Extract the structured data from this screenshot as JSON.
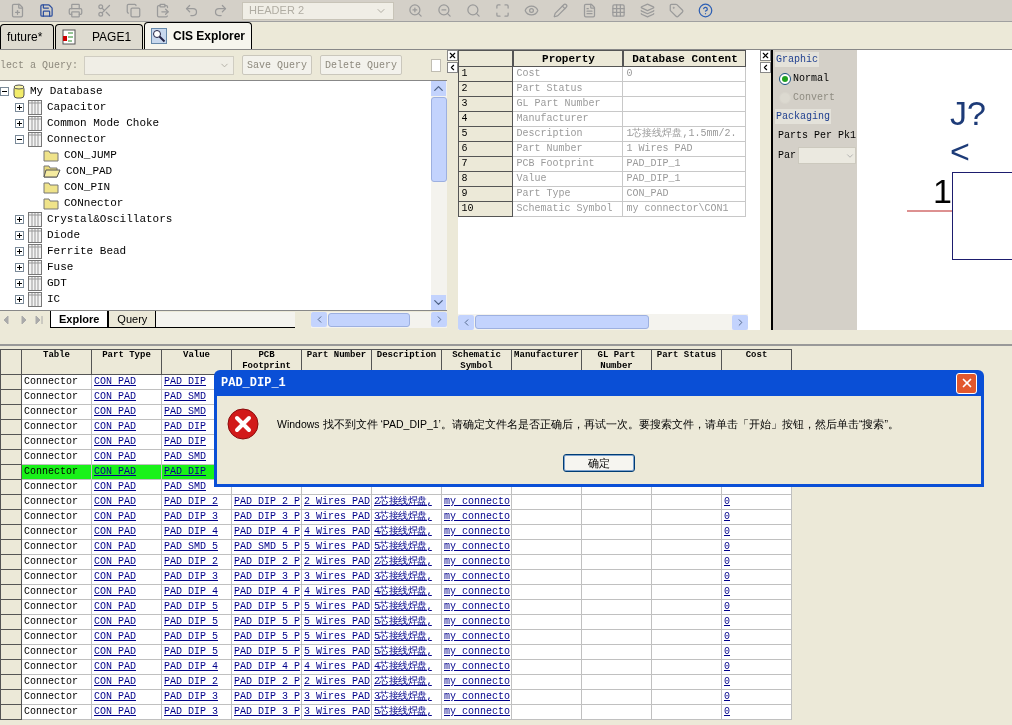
{
  "toolbar": {
    "style_combo": {
      "value": "HEADER 2",
      "disabled": true
    }
  },
  "document_tabs": [
    {
      "label": "future*",
      "selected": false,
      "kind": "plain"
    },
    {
      "label": "PAGE1",
      "selected": false,
      "kind": "schematic"
    },
    {
      "label": "CIS Explorer",
      "selected": true,
      "kind": "explorer"
    }
  ],
  "query_bar": {
    "label": "lect a Query:",
    "combo_disabled": true,
    "buttons": [
      {
        "label": "Save Query",
        "disabled": true
      },
      {
        "label": "Delete Query",
        "disabled": true
      }
    ],
    "checkbox": {
      "checked": false
    }
  },
  "tree": {
    "label": "My Database",
    "kind": "database",
    "expanded": true,
    "children": [
      {
        "label": "Capacitor",
        "kind": "table",
        "expanded": false
      },
      {
        "label": "Common Mode Choke",
        "kind": "table",
        "expanded": false
      },
      {
        "label": "Connector",
        "kind": "table",
        "expanded": true,
        "children": [
          {
            "label": "CON_JUMP",
            "kind": "folder",
            "selected": false
          },
          {
            "label": "CON_PAD",
            "kind": "folder",
            "selected": true
          },
          {
            "label": "CON_PIN",
            "kind": "folder",
            "selected": false
          },
          {
            "label": "CONnector",
            "kind": "folder",
            "selected": false
          }
        ]
      },
      {
        "label": "Crystal&Oscillators",
        "kind": "table",
        "expanded": false
      },
      {
        "label": "Diode",
        "kind": "table",
        "expanded": false
      },
      {
        "label": "Ferrite Bead",
        "kind": "table",
        "expanded": false
      },
      {
        "label": "Fuse",
        "kind": "table",
        "expanded": false
      },
      {
        "label": "GDT",
        "kind": "table",
        "expanded": false
      },
      {
        "label": "IC",
        "kind": "table",
        "expanded": false
      }
    ]
  },
  "explorer_tabs": [
    {
      "label": "Explore",
      "selected": true
    },
    {
      "label": "Query",
      "selected": false
    }
  ],
  "property_grid": {
    "columns": [
      "Property",
      "Database Content"
    ],
    "rows": [
      {
        "number": "1",
        "property": "Cost",
        "value": "0"
      },
      {
        "number": "2",
        "property": "Part Status"
      },
      {
        "number": "3",
        "property": "GL Part Number"
      },
      {
        "number": "4",
        "property": "Manufacturer"
      },
      {
        "number": "5",
        "property": "Description",
        "value": "1芯接线焊盘,1.5mm/2."
      },
      {
        "number": "6",
        "property": "Part Number",
        "value": "1 Wires PAD"
      },
      {
        "number": "7",
        "property": "PCB Footprint",
        "value": "PAD_DIP_1"
      },
      {
        "number": "8",
        "property": "Value",
        "value": "PAD_DIP_1"
      },
      {
        "number": "9",
        "property": "Part Type",
        "value": "CON_PAD"
      },
      {
        "number": "10",
        "property": "Schematic Symbol",
        "value": "my connector\\CON1"
      }
    ]
  },
  "preview_options": {
    "graphic_heading": "Graphic",
    "views": [
      {
        "label": "Normal",
        "selected": true,
        "disabled": false
      },
      {
        "label": "Convert",
        "selected": false,
        "disabled": true
      }
    ],
    "packaging_heading": "Packaging",
    "parts_per_package": "Parts Per Pk1",
    "part_label": "Par",
    "part_combo_disabled": true
  },
  "preview": {
    "reference": "J?",
    "value": "<",
    "pin_number": "1"
  },
  "parts_table": {
    "columns": [
      "Table",
      "Part Type",
      "Value",
      "PCB Footprint",
      "Part Number",
      "Description",
      "Schematic Symbol",
      "Manufacturer",
      "GL Part Number",
      "Part Status",
      "Cost"
    ],
    "rows": [
      {
        "table": "Connector",
        "part_type": "CON PAD",
        "value": "PAD DIP",
        "selected": false
      },
      {
        "table": "Connector",
        "part_type": "CON PAD",
        "value": "PAD SMD",
        "selected": false
      },
      {
        "table": "Connector",
        "part_type": "CON PAD",
        "value": "PAD SMD",
        "selected": false
      },
      {
        "table": "Connector",
        "part_type": "CON PAD",
        "value": "PAD DIP",
        "selected": false
      },
      {
        "table": "Connector",
        "part_type": "CON PAD",
        "value": "PAD DIP",
        "selected": false
      },
      {
        "table": "Connector",
        "part_type": "CON PAD",
        "value": "PAD SMD",
        "selected": false
      },
      {
        "table": "Connector",
        "part_type": "CON PAD",
        "value": "PAD DIP",
        "selected": true
      },
      {
        "table": "Connector",
        "part_type": "CON PAD",
        "value": "PAD SMD",
        "selected": false
      },
      {
        "table": "Connector",
        "part_type": "CON PAD",
        "value": "PAD DIP 2",
        "pcb_footprint": "PAD DIP 2 P",
        "part_number": "2 Wires PAD",
        "description": "2芯接线焊盘,",
        "schematic_symbol": "my connecto",
        "cost": "0",
        "selected": false
      },
      {
        "table": "Connector",
        "part_type": "CON PAD",
        "value": "PAD DIP 3",
        "pcb_footprint": "PAD DIP 3 P",
        "part_number": "3 Wires PAD",
        "description": "3芯接线焊盘,",
        "schematic_symbol": "my connecto",
        "cost": "0",
        "selected": false
      },
      {
        "table": "Connector",
        "part_type": "CON PAD",
        "value": "PAD DIP 4",
        "pcb_footprint": "PAD DIP 4 P",
        "part_number": "4 Wires PAD",
        "description": "4芯接线焊盘,",
        "schematic_symbol": "my connecto",
        "cost": "0",
        "selected": false
      },
      {
        "table": "Connector",
        "part_type": "CON PAD",
        "value": "PAD SMD 5",
        "pcb_footprint": "PAD SMD 5 P",
        "part_number": "5 Wires PAD",
        "description": "5芯接线焊盘,",
        "schematic_symbol": "my connecto",
        "cost": "0",
        "selected": false
      },
      {
        "table": "Connector",
        "part_type": "CON PAD",
        "value": "PAD DIP 2",
        "pcb_footprint": "PAD DIP 2 P",
        "part_number": "2 Wires PAD",
        "description": "2芯接线焊盘,",
        "schematic_symbol": "my connecto",
        "cost": "0",
        "selected": false
      },
      {
        "table": "Connector",
        "part_type": "CON PAD",
        "value": "PAD DIP 3",
        "pcb_footprint": "PAD DIP 3 P",
        "part_number": "3 Wires PAD",
        "description": "3芯接线焊盘,",
        "schematic_symbol": "my connecto",
        "cost": "0",
        "selected": false
      },
      {
        "table": "Connector",
        "part_type": "CON PAD",
        "value": "PAD DIP 4",
        "pcb_footprint": "PAD DIP 4 P",
        "part_number": "4 Wires PAD",
        "description": "4芯接线焊盘,",
        "schematic_symbol": "my connecto",
        "cost": "0",
        "selected": false
      },
      {
        "table": "Connector",
        "part_type": "CON PAD",
        "value": "PAD DIP 5",
        "pcb_footprint": "PAD DIP 5 P",
        "part_number": "5 Wires PAD",
        "description": "5芯接线焊盘,",
        "schematic_symbol": "my connecto",
        "cost": "0",
        "selected": false
      },
      {
        "table": "Connector",
        "part_type": "CON PAD",
        "value": "PAD DIP 5",
        "pcb_footprint": "PAD DIP 5 P",
        "part_number": "5 Wires PAD",
        "description": "5芯接线焊盘,",
        "schematic_symbol": "my connecto",
        "cost": "0",
        "selected": false
      },
      {
        "table": "Connector",
        "part_type": "CON PAD",
        "value": "PAD DIP 5",
        "pcb_footprint": "PAD DIP 5 P",
        "part_number": "5 Wires PAD",
        "description": "5芯接线焊盘,",
        "schematic_symbol": "my connecto",
        "cost": "0",
        "selected": false
      },
      {
        "table": "Connector",
        "part_type": "CON PAD",
        "value": "PAD DIP 5",
        "pcb_footprint": "PAD DIP 5 P",
        "part_number": "5 Wires PAD",
        "description": "5芯接线焊盘,",
        "schematic_symbol": "my connecto",
        "cost": "0",
        "selected": false
      },
      {
        "table": "Connector",
        "part_type": "CON PAD",
        "value": "PAD DIP 4",
        "pcb_footprint": "PAD DIP 4 P",
        "part_number": "4 Wires PAD",
        "description": "4芯接线焊盘,",
        "schematic_symbol": "my connecto",
        "cost": "0",
        "selected": false
      },
      {
        "table": "Connector",
        "part_type": "CON PAD",
        "value": "PAD DIP 2",
        "pcb_footprint": "PAD DIP 2 P",
        "part_number": "2 Wires PAD",
        "description": "2芯接线焊盘,",
        "schematic_symbol": "my connecto",
        "cost": "0",
        "selected": false
      },
      {
        "table": "Connector",
        "part_type": "CON PAD",
        "value": "PAD DIP 3",
        "pcb_footprint": "PAD DIP 3 P",
        "part_number": "3 Wires PAD",
        "description": "3芯接线焊盘,",
        "schematic_symbol": "my connecto",
        "cost": "0",
        "selected": false
      },
      {
        "table": "Connector",
        "part_type": "CON PAD",
        "value": "PAD DIP 3",
        "pcb_footprint": "PAD DIP 3 P",
        "part_number": "3 Wires PAD",
        "description": "5芯接线焊盘,",
        "schematic_symbol": "my connecto",
        "cost": "0",
        "selected": false
      }
    ]
  },
  "dialog": {
    "title": "PAD_DIP_1",
    "message": "Windows 找不到文件 ‘PAD_DIP_1’。请确定文件名是否正确后，再试一次。要搜索文件，请单击「开始」按钮，然后单击“搜索”。",
    "ok_button": "确定"
  }
}
